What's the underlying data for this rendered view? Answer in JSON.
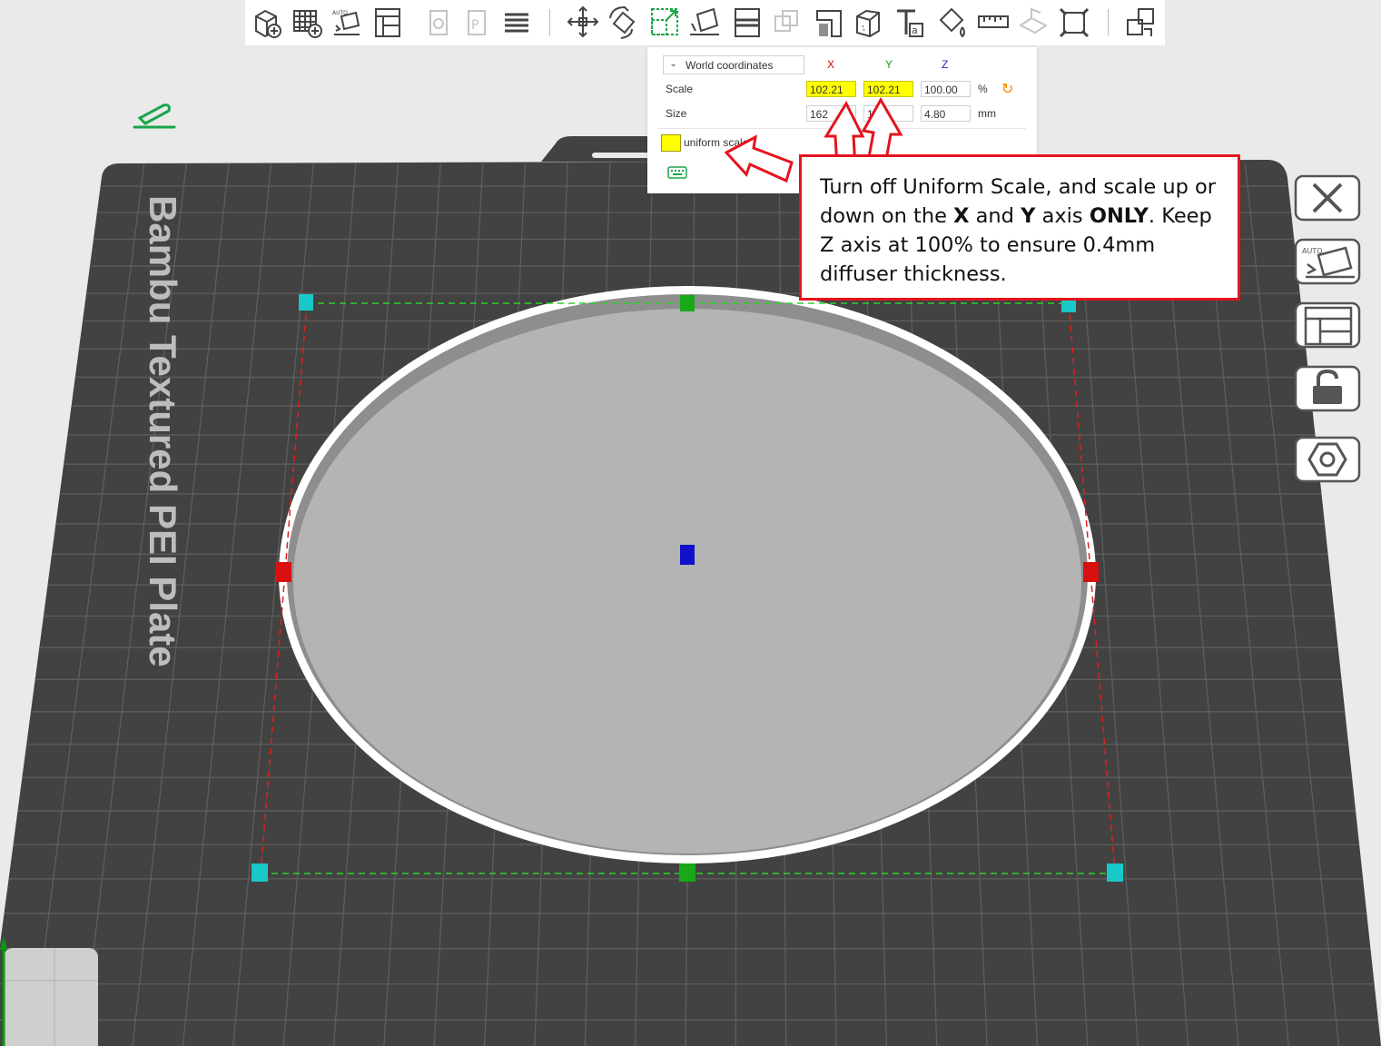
{
  "toolbar": {
    "buttons": [
      {
        "id": "add",
        "icon": "add-object-icon",
        "disabled": false
      },
      {
        "id": "add-plate",
        "icon": "add-plate-icon",
        "disabled": false
      },
      {
        "id": "auto-orient",
        "icon": "auto-orient-icon",
        "disabled": false
      },
      {
        "id": "arrange",
        "icon": "arrange-icon",
        "disabled": false
      },
      {
        "id": "copy",
        "icon": "copy-icon",
        "disabled": true
      },
      {
        "id": "paste",
        "icon": "paste-icon",
        "disabled": true
      },
      {
        "id": "layers",
        "icon": "layers-icon",
        "disabled": false
      },
      {
        "id": "move",
        "icon": "move-icon",
        "disabled": false
      },
      {
        "id": "rotate",
        "icon": "rotate-icon",
        "disabled": false
      },
      {
        "id": "scale",
        "icon": "scale-icon",
        "disabled": false
      },
      {
        "id": "lay-on-face",
        "icon": "lay-on-face-icon",
        "disabled": false
      },
      {
        "id": "cut",
        "icon": "cut-icon",
        "disabled": false
      },
      {
        "id": "boolean",
        "icon": "boolean-icon",
        "disabled": true
      },
      {
        "id": "support-paint",
        "icon": "support-paint-icon",
        "disabled": false
      },
      {
        "id": "seam-paint",
        "icon": "seam-paint-icon",
        "disabled": false
      },
      {
        "id": "text",
        "icon": "text-icon",
        "disabled": false
      },
      {
        "id": "color-paint",
        "icon": "color-paint-icon",
        "disabled": false
      },
      {
        "id": "measure",
        "icon": "measure-icon",
        "disabled": false
      },
      {
        "id": "assembly",
        "icon": "assembly-icon",
        "disabled": true
      },
      {
        "id": "fit",
        "icon": "fit-view-icon",
        "disabled": false
      },
      {
        "id": "explode",
        "icon": "explode-icon",
        "disabled": false
      }
    ]
  },
  "scale_panel": {
    "coord_mode": "World coordinates",
    "axis_x": "X",
    "axis_y": "Y",
    "axis_z": "Z",
    "scale_label": "Scale",
    "size_label": "Size",
    "scale_x": "102.21",
    "scale_y": "102.21",
    "scale_z": "100.00",
    "size_x": "162",
    "size_y": "16    6",
    "size_z": "4.80",
    "percent_unit": "%",
    "mm_unit": "mm",
    "uniform_label": "uniform scale",
    "uniform_checked": false
  },
  "annotation": {
    "t1": "Turn off Uniform Scale, and scale up or down on the ",
    "x": "X",
    "t2": " and ",
    "y": "Y",
    "t3": " axis ",
    "only": "ONLY",
    "t4": ". Keep Z axis at 100% to ensure 0.4mm diffuser thickness."
  },
  "plate": {
    "label": "Bambu Textured PEI Plate"
  },
  "side_toolbar": {
    "buttons": [
      {
        "id": "close",
        "icon": "close-icon"
      },
      {
        "id": "auto-orient",
        "icon": "auto-orient-icon"
      },
      {
        "id": "arrange",
        "icon": "arrange-icon"
      },
      {
        "id": "lock",
        "icon": "lock-icon"
      },
      {
        "id": "nozzle",
        "icon": "hex-nut-icon"
      }
    ]
  },
  "colors": {
    "plate": "#424242",
    "grid": "#5e5e5e",
    "accent_red": "#e3141e",
    "highlight": "#ffff00",
    "axis_x": "#e00000",
    "axis_y": "#14a014",
    "axis_z": "#2020c0"
  }
}
